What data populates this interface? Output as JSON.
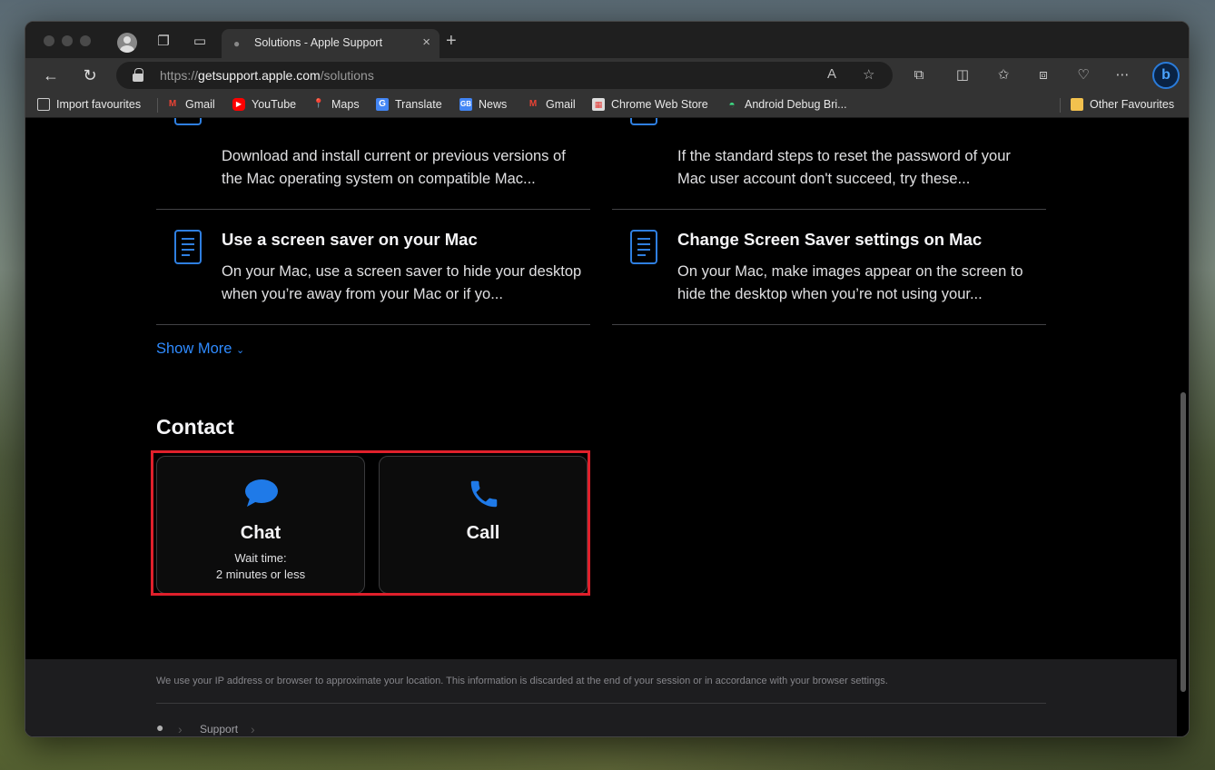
{
  "browser": {
    "tab_title": "Solutions - Apple Support",
    "url_prefix": "https://",
    "url_host": "getsupport.apple.com",
    "url_path": "/solutions",
    "bookmarks": [
      {
        "label": "Import favourites",
        "icon": "import-icon",
        "color": "#cccccc"
      },
      {
        "label": "Gmail",
        "icon": "gmail-icon",
        "color": "#ea4335"
      },
      {
        "label": "YouTube",
        "icon": "youtube-icon",
        "color": "#ff0000"
      },
      {
        "label": "Maps",
        "icon": "maps-icon",
        "color": "#34a853"
      },
      {
        "label": "Translate",
        "icon": "translate-icon",
        "color": "#4285f4"
      },
      {
        "label": "News",
        "icon": "news-icon",
        "color": "#4285f4"
      },
      {
        "label": "Gmail",
        "icon": "gmail-icon",
        "color": "#ea4335"
      },
      {
        "label": "Chrome Web Store",
        "icon": "webstore-icon",
        "color": "#f4b400"
      },
      {
        "label": "Android Debug Bri...",
        "icon": "android-icon",
        "color": "#3ddc84"
      }
    ],
    "other_favourites": "Other Favourites"
  },
  "solutions": [
    {
      "title": "",
      "description": "Download and install current or previous versions of the Mac operating system on compatible Mac..."
    },
    {
      "title": "",
      "description": "If the standard steps to reset the password of your Mac user account don't succeed, try these..."
    },
    {
      "title": "Use a screen saver on your Mac",
      "description": "On your Mac, use a screen saver to hide your desktop when you’re away from your Mac or if yo..."
    },
    {
      "title": "Change Screen Saver settings on Mac",
      "description": "On your Mac, make images appear on the screen to hide the desktop when you’re not using your..."
    }
  ],
  "show_more": "Show More",
  "contact": {
    "heading": "Contact",
    "chat": {
      "label": "Chat",
      "wait_label": "Wait time:",
      "wait_value": "2 minutes or less"
    },
    "call": {
      "label": "Call"
    }
  },
  "footer": {
    "note": "We use your IP address or browser to approximate your location. This information is discarded at the end of your session or in accordance with your browser settings.",
    "breadcrumb": "Support"
  },
  "colors": {
    "accent": "#2f7fe0",
    "highlight": "#e0202b"
  }
}
